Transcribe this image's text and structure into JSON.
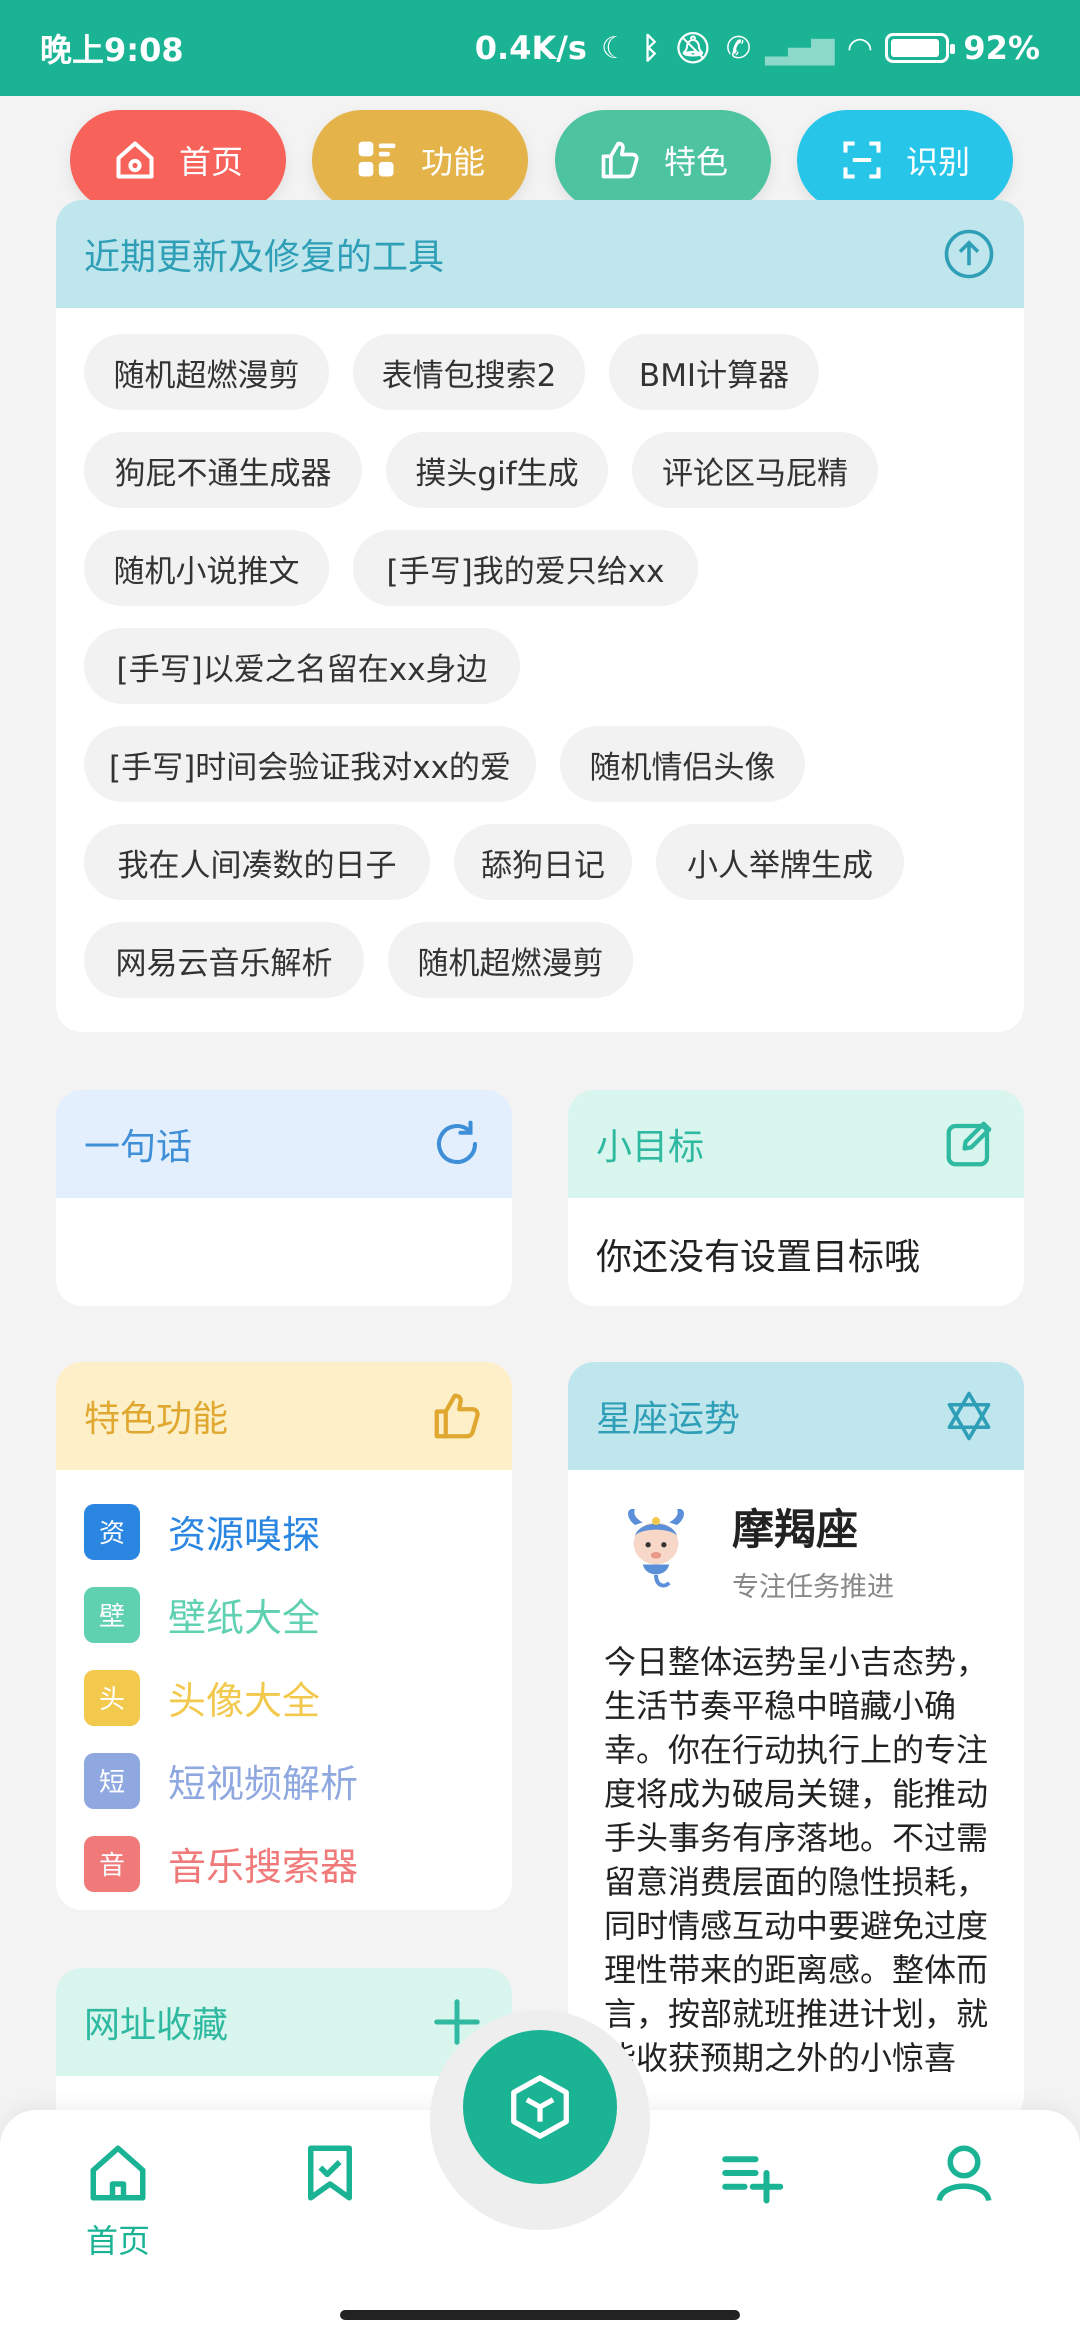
{
  "status": {
    "time": "晚上9:08",
    "speed": "0.4K/s",
    "battery": "92%"
  },
  "topnav": [
    {
      "label": "首页",
      "icon": "home-icon",
      "color": "#f7625a"
    },
    {
      "label": "功能",
      "icon": "grid-icon",
      "color": "#e4b34a"
    },
    {
      "label": "特色",
      "icon": "thumb-up-icon",
      "color": "#4dc3a0"
    },
    {
      "label": "识别",
      "icon": "scan-icon",
      "color": "#27c6e8"
    }
  ],
  "updates": {
    "title": "近期更新及修复的工具",
    "chips": [
      "随机超燃漫剪",
      "表情包搜索2",
      "BMI计算器",
      "狗屁不通生成器",
      "摸头gif生成",
      "评论区马屁精",
      "随机小说推文",
      "[手写]我的爱只给xx",
      "[手写]以爱之名留在xx身边",
      "[手写]时间会验证我对xx的爱",
      "随机情侣头像",
      "我在人间凑数的日子",
      "舔狗日记",
      "小人举牌生成",
      "网易云音乐解析",
      "随机超燃漫剪"
    ]
  },
  "quote": {
    "title": "一句话",
    "text": ""
  },
  "goal": {
    "title": "小目标",
    "text": "你还没有设置目标哦"
  },
  "features": {
    "title": "特色功能",
    "items": [
      {
        "badge": "资",
        "label": "资源嗅探",
        "color": "#2a86e0"
      },
      {
        "badge": "壁",
        "label": "壁纸大全",
        "color": "#5fd0b0"
      },
      {
        "badge": "头",
        "label": "头像大全",
        "color": "#f2c94c"
      },
      {
        "badge": "短",
        "label": "短视频解析",
        "color": "#8fa8e0"
      },
      {
        "badge": "音",
        "label": "音乐搜索器",
        "color": "#f07a7a"
      }
    ]
  },
  "horoscope": {
    "title": "星座运势",
    "sign": "摩羯座",
    "tagline": "专注任务推进",
    "text": "今日整体运势呈小吉态势，生活节奏平稳中暗藏小确幸。你在行动执行上的专注度将成为破局关键，能推动手头事务有序落地。不过需留意消费层面的隐性损耗，同时情感互动中要避免过度理性带来的距离感。整体而言，按部就班推进计划，就能收获预期之外的小惊喜"
  },
  "bookmarks": {
    "title": "网址收藏"
  },
  "bottombar": {
    "home_label": "首页"
  },
  "colors": {
    "accent": "#1ab394"
  }
}
